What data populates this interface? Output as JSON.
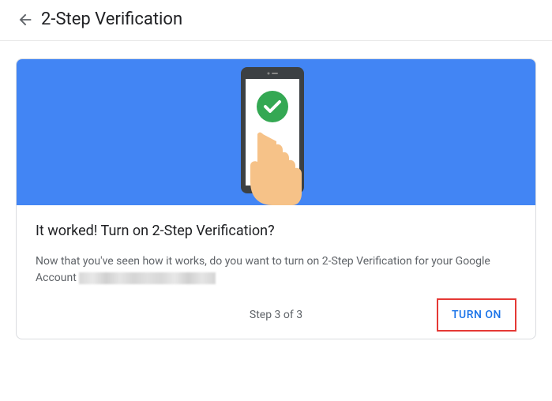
{
  "header": {
    "title": "2-Step Verification"
  },
  "content": {
    "heading": "It worked! Turn on 2-Step Verification?",
    "body_prefix": "Now that you've seen how it works, do you want to turn on 2-Step Verification for your Google Account "
  },
  "footer": {
    "step_label": "Step 3 of 3",
    "turn_on_label": "TURN ON"
  }
}
